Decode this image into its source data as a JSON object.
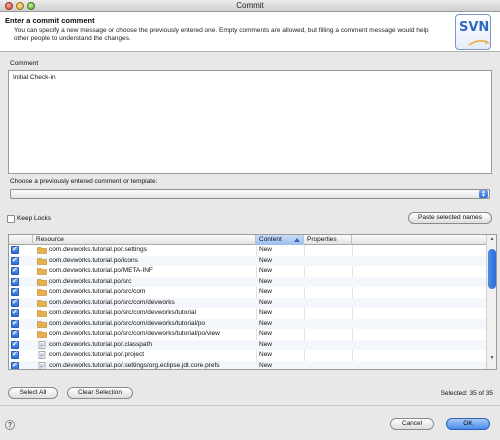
{
  "window": {
    "title": "Commit"
  },
  "header": {
    "title": "Enter a commit comment",
    "description": "You can specify a new message or choose the previously entered one. Empty comments are allowed, but filling a comment message would help other people to understand the changes.",
    "logo_text": "SVN"
  },
  "comment": {
    "label": "Comment",
    "value": "Initial Check-in"
  },
  "template": {
    "label": "Choose a previously entered comment or template:",
    "selected": ""
  },
  "keep_locks": {
    "label": "Keep Locks",
    "checked": false
  },
  "paste_button": {
    "label": "Paste selected names"
  },
  "table": {
    "columns": [
      "Resource",
      "Content",
      "Properties"
    ],
    "sorted_column": "Content",
    "rows": [
      {
        "icon": "folder-icon",
        "resource": "com.devworks.tutorial.po/.settings",
        "content": "New",
        "properties": "",
        "checked": true
      },
      {
        "icon": "folder-icon",
        "resource": "com.devworks.tutorial.po/icons",
        "content": "New",
        "properties": "",
        "checked": true
      },
      {
        "icon": "folder-icon",
        "resource": "com.devworks.tutorial.po/META-INF",
        "content": "New",
        "properties": "",
        "checked": true
      },
      {
        "icon": "folder-icon",
        "resource": "com.devworks.tutorial.po/src",
        "content": "New",
        "properties": "",
        "checked": true
      },
      {
        "icon": "folder-icon",
        "resource": "com.devworks.tutorial.po/src/com",
        "content": "New",
        "properties": "",
        "checked": true
      },
      {
        "icon": "folder-icon",
        "resource": "com.devworks.tutorial.po/src/com/devworks",
        "content": "New",
        "properties": "",
        "checked": true
      },
      {
        "icon": "folder-icon",
        "resource": "com.devworks.tutorial.po/src/com/devworks/tutorial",
        "content": "New",
        "properties": "",
        "checked": true
      },
      {
        "icon": "folder-icon",
        "resource": "com.devworks.tutorial.po/src/com/devworks/tutorial/po",
        "content": "New",
        "properties": "",
        "checked": true
      },
      {
        "icon": "folder-icon",
        "resource": "com.devworks.tutorial.po/src/com/devworks/tutorial/po/view",
        "content": "New",
        "properties": "",
        "checked": true
      },
      {
        "icon": "file-icon",
        "resource": "com.devworks.tutorial.po/.classpath",
        "content": "New",
        "properties": "",
        "checked": true
      },
      {
        "icon": "file-icon",
        "resource": "com.devworks.tutorial.po/.project",
        "content": "New",
        "properties": "",
        "checked": true
      },
      {
        "icon": "file-icon",
        "resource": "com.devworks.tutorial.po/.settings/org.eclipse.jdt.core.prefs",
        "content": "New",
        "properties": "",
        "checked": true
      }
    ]
  },
  "buttons": {
    "select_all": "Select All",
    "clear_selection": "Clear Selection",
    "cancel": "Cancel",
    "ok": "OK",
    "help": "?"
  },
  "selection_status": "Selected: 35 of 35",
  "colors": {
    "accent": "#2a6ed8",
    "folder": "#e8b04a",
    "svn_blue": "#2f68c0"
  }
}
